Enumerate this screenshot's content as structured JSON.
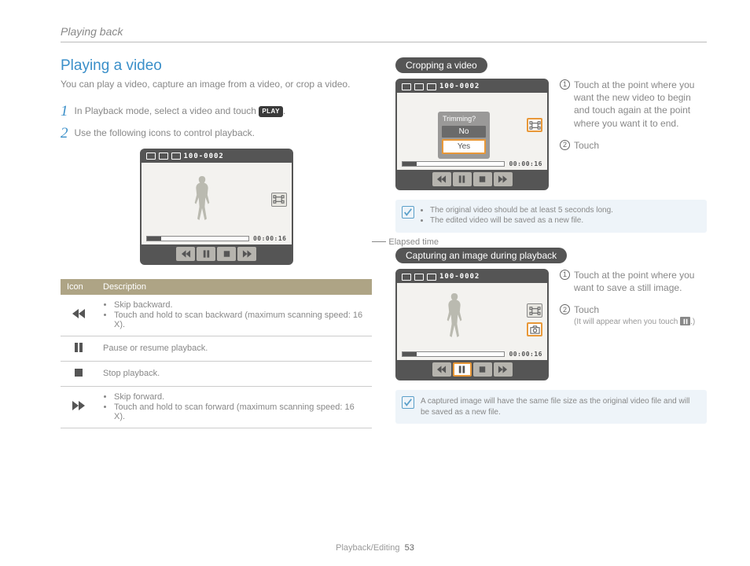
{
  "breadcrumb": "Playing back",
  "title": "Playing a video",
  "intro": "You can play a video, capture an image from a video, or crop a video.",
  "steps": [
    {
      "n": "1",
      "text_a": "In Playback mode, select a video and touch ",
      "text_b": "."
    },
    {
      "n": "2",
      "text_a": "Use the following icons to control playback."
    }
  ],
  "play_chip": "PLAY",
  "file_label": "100-0002",
  "elapsed_time": "00:00:16",
  "elapsed_label": "Elapsed time",
  "table": {
    "h1": "Icon",
    "h2": "Description",
    "rows": [
      {
        "b1": "Skip backward.",
        "b2": "Touch and hold to scan backward (maximum scanning speed: 16 X)."
      },
      {
        "d": "Pause or resume playback."
      },
      {
        "d": "Stop playback."
      },
      {
        "b1": "Skip forward.",
        "b2": "Touch and hold to scan forward (maximum scanning speed: 16 X)."
      }
    ]
  },
  "crop": {
    "pill": "Cropping a video",
    "a1": "Touch at the point where you want the new video to begin and touch again at the point where you want it to end.",
    "a2": "Touch",
    "dlg_t": "Trimming?",
    "dlg_no": "No",
    "dlg_yes": "Yes",
    "notes": [
      "The original video should be at least 5 seconds long.",
      "The edited video will be saved as a new file."
    ]
  },
  "capture": {
    "pill": "Capturing an image during playback",
    "a1": "Touch at the point where you want to save a still image.",
    "a2": "Touch",
    "sub": "(It will appear when you touch ",
    "sub_end": ".)",
    "note": "A captured image will have the same file size as the original video file and will be saved as a new file."
  },
  "footer": {
    "section": "Playback/Editing",
    "page": "53"
  }
}
